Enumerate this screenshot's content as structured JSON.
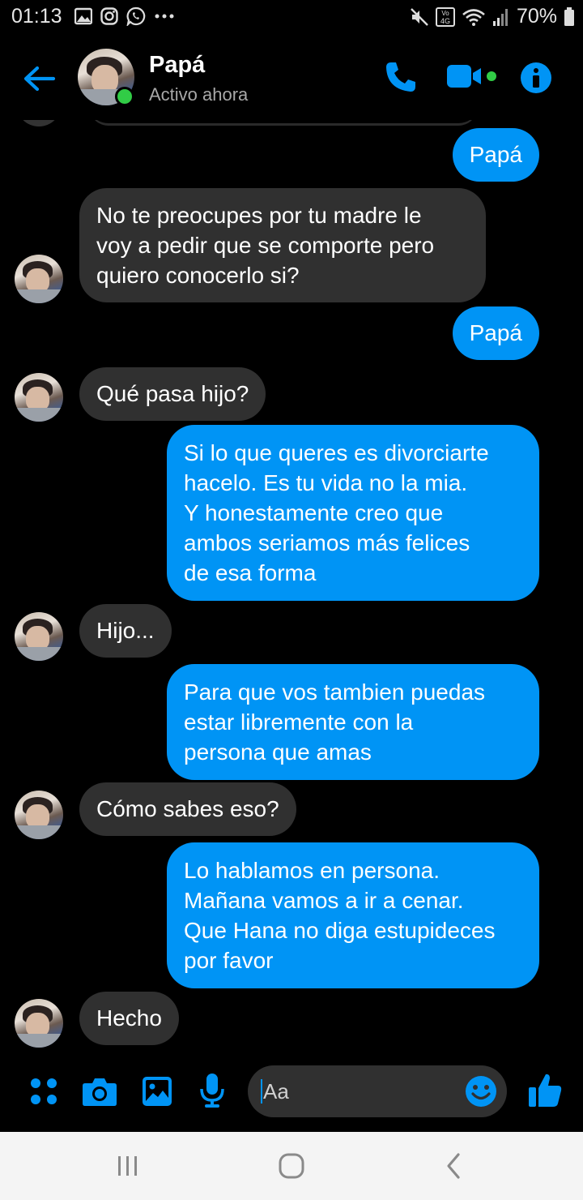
{
  "status_bar": {
    "time": "01:13",
    "battery": "70%",
    "left_icons": [
      "gallery-icon",
      "instagram-icon",
      "whatsapp-icon",
      "more-icon"
    ],
    "right_icons": [
      "mute-icon",
      "volte-4g-icon",
      "wifi-icon",
      "signal-icon",
      "battery-icon"
    ],
    "network_label": "Vo 4G"
  },
  "header": {
    "contact_name": "Papá",
    "contact_status": "Activo ahora",
    "actions": [
      "phone-call-icon",
      "video-call-icon",
      "info-icon"
    ]
  },
  "messages": [
    {
      "dir": "out",
      "text": "Papá"
    },
    {
      "dir": "in",
      "text": "No te preocupes por tu madre le\nvoy a pedir que se comporte pero\nquiero conocerlo si?"
    },
    {
      "dir": "out",
      "text": "Papá"
    },
    {
      "dir": "in",
      "text": "Qué pasa hijo?"
    },
    {
      "dir": "out",
      "text": "Si lo que queres es divorciarte\nhacelo. Es tu vida no la mia.\nY honestamente creo que\nambos seriamos más felices\nde esa forma"
    },
    {
      "dir": "in",
      "text": "Hijo..."
    },
    {
      "dir": "out",
      "text": "Para que vos tambien puedas\nestar libremente con la\npersona que amas"
    },
    {
      "dir": "in",
      "text": "Cómo sabes eso?"
    },
    {
      "dir": "out",
      "text": "Lo hablamos en persona.\nMañana vamos a ir a cenar.\nQue Hana no diga estupideces\npor favor"
    },
    {
      "dir": "in",
      "text": "Hecho"
    }
  ],
  "composer": {
    "placeholder": "Aa",
    "icons": [
      "more-actions-icon",
      "camera-icon",
      "gallery-icon",
      "microphone-icon",
      "emoji-icon",
      "thumbs-up-icon"
    ]
  },
  "colors": {
    "accent": "#0094f5",
    "incoming_bubble": "#303030",
    "background": "#000000",
    "online": "#31cc46"
  }
}
